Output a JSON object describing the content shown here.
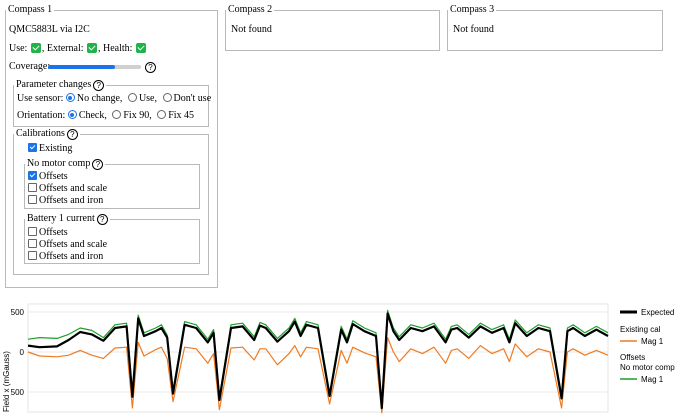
{
  "compass1": {
    "legend": "Compass 1",
    "device": "QMC5883L via I2C",
    "use_label": "Use:",
    "external_label": ", External:",
    "health_label": ", Health:",
    "coverage_label": "Coverage:",
    "coverage": 0.72,
    "param_changes": {
      "legend": "Parameter changes",
      "use_sensor_label": "Use sensor:",
      "use_sensor_options": [
        "No change,",
        "Use,",
        "Don't use"
      ],
      "use_sensor_selected": 0,
      "orientation_label": "Orientation:",
      "orientation_options": [
        "Check,",
        "Fix 90,",
        "Fix 45"
      ],
      "orientation_selected": 0
    },
    "calibrations": {
      "legend": "Calibrations",
      "existing_label": "Existing",
      "no_motor": {
        "legend": "No motor comp",
        "options": [
          "Offsets",
          "Offsets and scale",
          "Offsets and iron"
        ],
        "checked": [
          true,
          false,
          false
        ]
      },
      "battery": {
        "legend": "Battery 1 current",
        "options": [
          "Offsets",
          "Offsets and scale",
          "Offsets and iron"
        ],
        "checked": [
          false,
          false,
          false
        ]
      }
    }
  },
  "compass2": {
    "legend": "Compass 2",
    "status": "Not found"
  },
  "compass3": {
    "legend": "Compass 3",
    "status": "Not found"
  },
  "colors": {
    "expected": "#000000",
    "existing": "#f07a1f",
    "offsets": "#1f9e2c",
    "check": "#1fb34a",
    "accent": "#1a73e8"
  },
  "chart_data": {
    "type": "line",
    "ylabel": "Field x (mGauss)",
    "yticks": [
      "500",
      "0",
      "500"
    ],
    "ylim": [
      -750,
      600
    ],
    "x_range": [
      0,
      100
    ],
    "legend": {
      "expected": "Expected",
      "existing_group": "Existing cal",
      "mag": "Mag 1",
      "offsets_group": "Offsets",
      "no_motor_group": "No motor comp"
    },
    "series": [
      {
        "name": "Expected",
        "color": "#000000",
        "x": [
          0,
          2,
          5,
          7,
          9,
          11,
          13,
          15,
          17,
          18,
          19,
          20,
          22,
          23,
          24,
          25,
          27,
          29,
          31,
          32,
          33,
          35,
          37,
          39,
          40,
          41,
          43,
          45,
          46,
          47,
          48,
          50,
          52,
          54,
          55,
          56,
          58,
          60,
          61,
          62,
          63,
          64,
          66,
          68,
          70,
          72,
          73,
          74,
          76,
          78,
          80,
          82,
          83,
          84,
          86,
          88,
          90,
          92,
          93,
          94,
          96,
          98,
          100
        ],
        "y": [
          80,
          60,
          70,
          150,
          250,
          220,
          140,
          300,
          320,
          -560,
          420,
          200,
          260,
          300,
          180,
          -520,
          340,
          300,
          120,
          240,
          -600,
          300,
          320,
          150,
          330,
          300,
          130,
          260,
          380,
          200,
          340,
          300,
          -550,
          280,
          120,
          350,
          260,
          200,
          -700,
          480,
          260,
          150,
          300,
          260,
          320,
          120,
          280,
          300,
          180,
          320,
          240,
          300,
          120,
          360,
          200,
          300,
          260,
          -580,
          260,
          300,
          200,
          280,
          200
        ]
      },
      {
        "name": "Mag 1 (Existing cal)",
        "color": "#f07a1f",
        "x": [
          0,
          2,
          5,
          7,
          9,
          11,
          13,
          15,
          17,
          18,
          19,
          20,
          22,
          23,
          24,
          25,
          27,
          29,
          31,
          32,
          33,
          35,
          37,
          39,
          40,
          41,
          43,
          45,
          46,
          47,
          48,
          50,
          52,
          54,
          55,
          56,
          58,
          60,
          61,
          62,
          63,
          64,
          66,
          68,
          70,
          72,
          73,
          74,
          76,
          78,
          80,
          82,
          83,
          84,
          86,
          88,
          90,
          92,
          93,
          94,
          96,
          98,
          100
        ],
        "y": [
          0,
          -50,
          -60,
          -40,
          20,
          -40,
          -80,
          50,
          60,
          -700,
          120,
          -50,
          30,
          60,
          -80,
          -620,
          60,
          40,
          -140,
          -20,
          -720,
          50,
          60,
          -100,
          40,
          40,
          -160,
          -20,
          80,
          -60,
          60,
          40,
          -650,
          20,
          -140,
          60,
          -10,
          -60,
          -760,
          180,
          0,
          -120,
          40,
          -20,
          60,
          -140,
          20,
          40,
          -80,
          80,
          -20,
          40,
          -120,
          100,
          -60,
          40,
          0,
          -700,
          0,
          40,
          -40,
          20,
          -40
        ]
      },
      {
        "name": "Mag 1 (No motor comp offsets)",
        "color": "#1f9e2c",
        "x": [
          0,
          2,
          5,
          7,
          9,
          11,
          13,
          15,
          17,
          18,
          19,
          20,
          22,
          23,
          24,
          25,
          27,
          29,
          31,
          32,
          33,
          35,
          37,
          39,
          40,
          41,
          43,
          45,
          46,
          47,
          48,
          50,
          52,
          54,
          55,
          56,
          58,
          60,
          61,
          62,
          63,
          64,
          66,
          68,
          70,
          72,
          73,
          74,
          76,
          78,
          80,
          82,
          83,
          84,
          86,
          88,
          90,
          92,
          93,
          94,
          96,
          98,
          100
        ],
        "y": [
          160,
          180,
          170,
          220,
          300,
          270,
          180,
          340,
          360,
          -520,
          460,
          240,
          300,
          340,
          210,
          -480,
          380,
          340,
          160,
          280,
          -560,
          340,
          360,
          190,
          370,
          340,
          170,
          300,
          420,
          240,
          380,
          340,
          -510,
          320,
          160,
          390,
          300,
          240,
          -660,
          520,
          300,
          190,
          340,
          300,
          360,
          160,
          320,
          340,
          220,
          360,
          280,
          340,
          160,
          400,
          240,
          340,
          300,
          -540,
          300,
          340,
          240,
          320,
          240
        ]
      }
    ]
  }
}
